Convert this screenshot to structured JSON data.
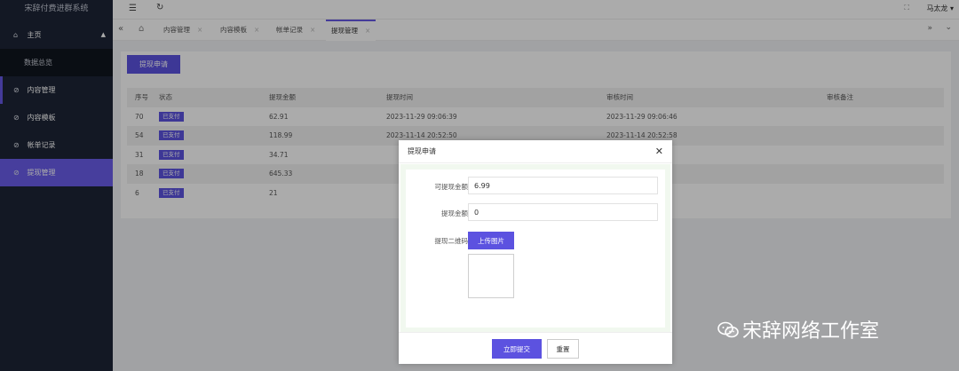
{
  "app": {
    "title": "宋辞付费进群系统"
  },
  "header": {
    "user": "马太龙 ▾"
  },
  "sidebar": {
    "home": {
      "label": "主页"
    },
    "items": [
      {
        "label": "数据总览"
      },
      {
        "label": "内容管理"
      },
      {
        "label": "内容模板"
      },
      {
        "label": "帐单记录"
      },
      {
        "label": "提现管理"
      }
    ]
  },
  "tabs": [
    {
      "label": "内容管理"
    },
    {
      "label": "内容模板"
    },
    {
      "label": "帐单记录"
    },
    {
      "label": "提现管理"
    }
  ],
  "main": {
    "apply_button": "提现申请",
    "columns": [
      "序号",
      "状态",
      "提现金额",
      "提现时间",
      "审核时间",
      "审核备注"
    ],
    "rows": [
      {
        "id": "70",
        "status": "已支付",
        "amount": "62.91",
        "time": "2023-11-29 09:06:39",
        "review_time": "2023-11-29 09:06:46",
        "note": ""
      },
      {
        "id": "54",
        "status": "已支付",
        "amount": "118.99",
        "time": "2023-11-14 20:52:50",
        "review_time": "2023-11-14 20:52:58",
        "note": ""
      },
      {
        "id": "31",
        "status": "已支付",
        "amount": "34.71",
        "time": "",
        "review_time": "",
        "note": ""
      },
      {
        "id": "18",
        "status": "已支付",
        "amount": "645.33",
        "time": "",
        "review_time": "",
        "note": ""
      },
      {
        "id": "6",
        "status": "已支付",
        "amount": "21",
        "time": "",
        "review_time": "",
        "note": ""
      }
    ]
  },
  "modal": {
    "title": "提现申请",
    "available_label": "可提现金额",
    "available_value": "6.99",
    "amount_label": "提现金额",
    "amount_value": "0",
    "qrcode_label": "提现二维码",
    "upload_button": "上传图片",
    "submit_button": "立即提交",
    "reset_button": "重置"
  },
  "watermark": {
    "text": "宋辞网络工作室"
  },
  "colors": {
    "accent": "#5c52e0",
    "sidebar": "#1d2436",
    "sidebar_active": "#6a5dea"
  },
  "icons": [
    "menu-icon",
    "refresh-icon",
    "home-icon",
    "shield-icon",
    "close-icon",
    "chevron-double-left-icon",
    "chevron-double-right-icon",
    "chevron-down-icon",
    "fullscreen-icon",
    "wechat-icon"
  ]
}
